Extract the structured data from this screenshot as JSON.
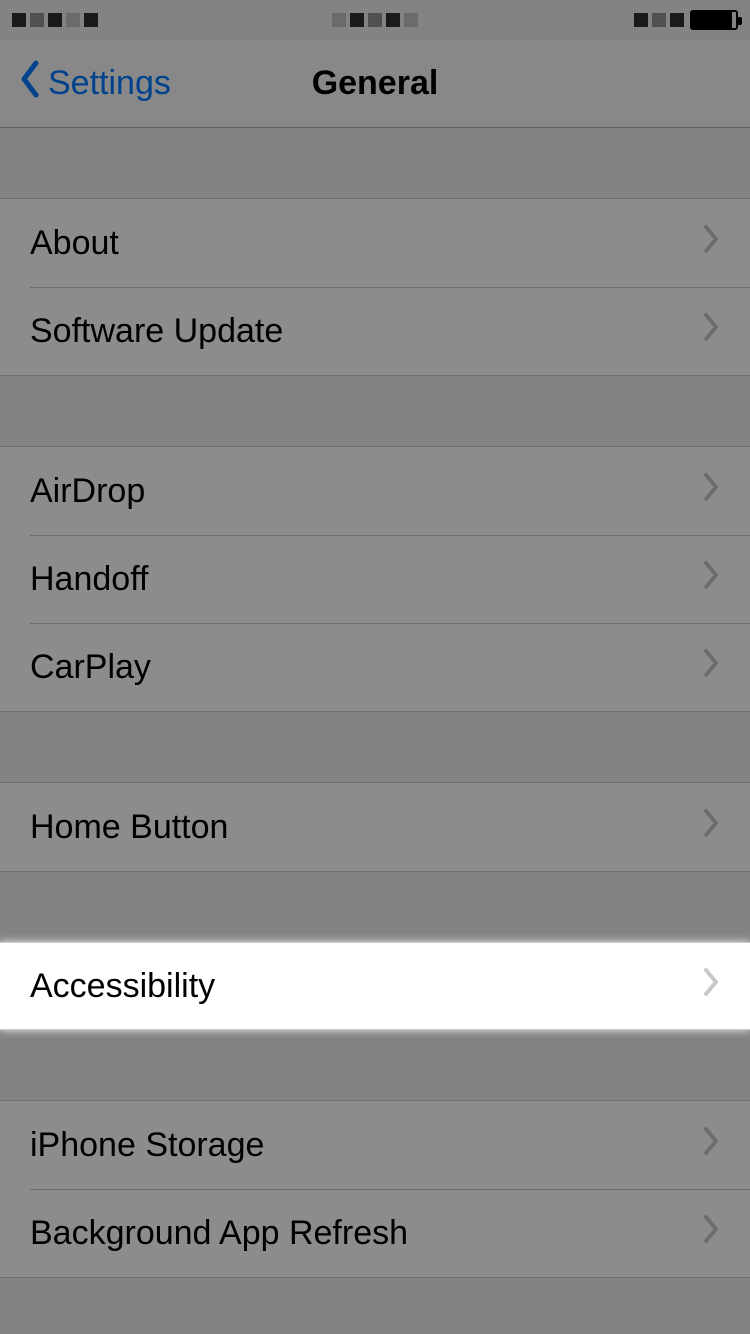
{
  "nav": {
    "back_label": "Settings",
    "title": "General"
  },
  "groups": [
    {
      "rows": [
        {
          "id": "about",
          "label": "About"
        },
        {
          "id": "software-update",
          "label": "Software Update"
        }
      ]
    },
    {
      "rows": [
        {
          "id": "airdrop",
          "label": "AirDrop"
        },
        {
          "id": "handoff",
          "label": "Handoff"
        },
        {
          "id": "carplay",
          "label": "CarPlay"
        }
      ]
    },
    {
      "rows": [
        {
          "id": "home-button",
          "label": "Home Button"
        }
      ]
    },
    {
      "rows": [
        {
          "id": "accessibility",
          "label": "Accessibility",
          "highlighted": true
        }
      ]
    },
    {
      "rows": [
        {
          "id": "iphone-storage",
          "label": "iPhone Storage"
        },
        {
          "id": "background-app-refresh",
          "label": "Background App Refresh"
        }
      ]
    }
  ]
}
